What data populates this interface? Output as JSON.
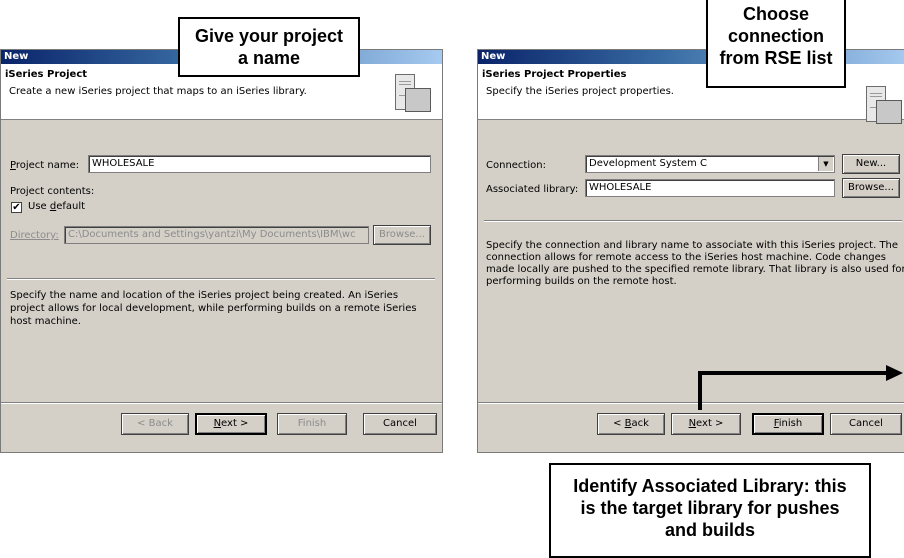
{
  "dialog_left": {
    "window_title": "New",
    "banner_title": "iSeries Project",
    "banner_desc": "Create a new iSeries project that maps to an iSeries library.",
    "project_name_label_u": "P",
    "project_name_label_rest": "roject name:",
    "project_name_value": "WHOLESALE",
    "project_contents_label": "Project contents:",
    "use_default_check": "✔",
    "use_default_label_a": "Use ",
    "use_default_label_u": "d",
    "use_default_label_b": "efault",
    "directory_label": "Directory:",
    "directory_value": "C:\\Documents and Settings\\yantzi\\My Documents\\IBM\\wc",
    "browse_button": "Browse...",
    "description_lines": [
      "Specify the name and location of the iSeries project being created. An iSeries",
      "project allows for local development, while performing builds on a remote iSeries",
      "host machine."
    ],
    "back_button": "< Back",
    "next_button": "Next >",
    "finish_button": "Finish",
    "cancel_button": "Cancel"
  },
  "dialog_right": {
    "window_title": "New",
    "banner_title": "iSeries Project Properties",
    "banner_desc": "Specify the iSeries project properties.",
    "connection_label": "Connection:",
    "connection_value": "Development System C",
    "dropdown_arrow": "▼",
    "new_button": "New...",
    "library_label": "Associated library:",
    "library_value": "WHOLESALE",
    "browse_button": "Browse...",
    "description_lines": [
      "Specify the connection and library name to associate with this iSeries project. The",
      "connection allows for remote access to the iSeries host machine. Code changes",
      "made locally are pushed to the specified remote library. That library is also used for",
      "performing builds on the remote host."
    ],
    "back_button": "< Back",
    "next_button": "Next >",
    "finish_button": "Finish",
    "cancel_button": "Cancel"
  },
  "callouts": {
    "name_lines": [
      "Give your project",
      "a name"
    ],
    "connection_lines": [
      "Choose",
      "connection",
      "from RSE list"
    ],
    "library_lines": [
      "Identify Associated Library: this",
      "is the target library for pushes",
      "and builds"
    ]
  }
}
